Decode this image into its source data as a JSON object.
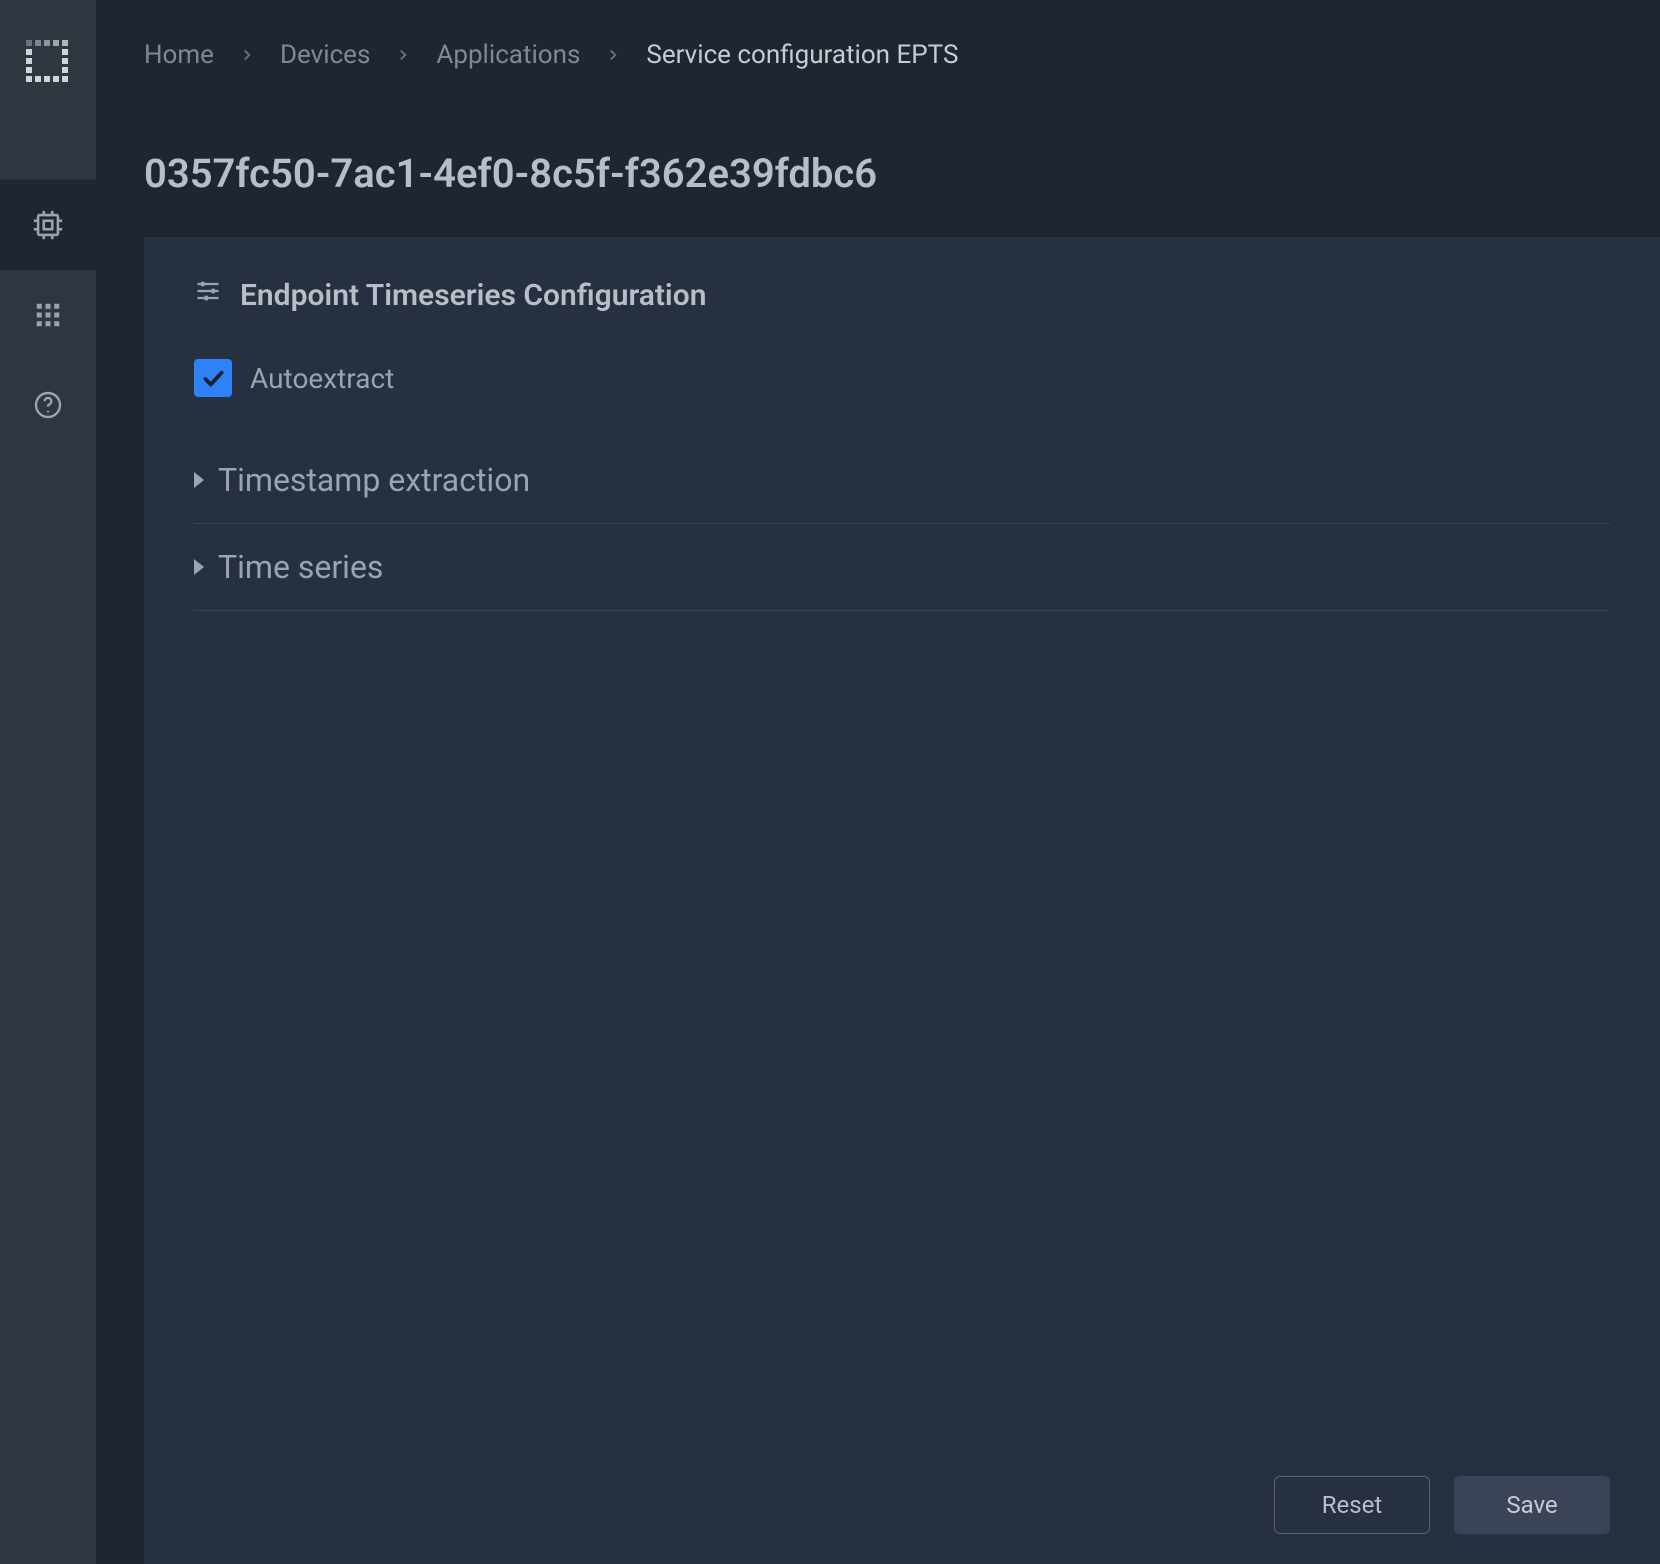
{
  "breadcrumb": {
    "items": [
      {
        "label": "Home"
      },
      {
        "label": "Devices"
      },
      {
        "label": "Applications"
      },
      {
        "label": "Service configuration EPTS"
      }
    ]
  },
  "page": {
    "title": "0357fc50-7ac1-4ef0-8c5f-f362e39fdbc6"
  },
  "panel": {
    "heading": "Endpoint Timeseries Configuration",
    "autoextract_label": "Autoextract",
    "autoextract_checked": true,
    "sections": [
      {
        "label": "Timestamp extraction"
      },
      {
        "label": "Time series"
      }
    ]
  },
  "footer": {
    "reset_label": "Reset",
    "save_label": "Save"
  }
}
